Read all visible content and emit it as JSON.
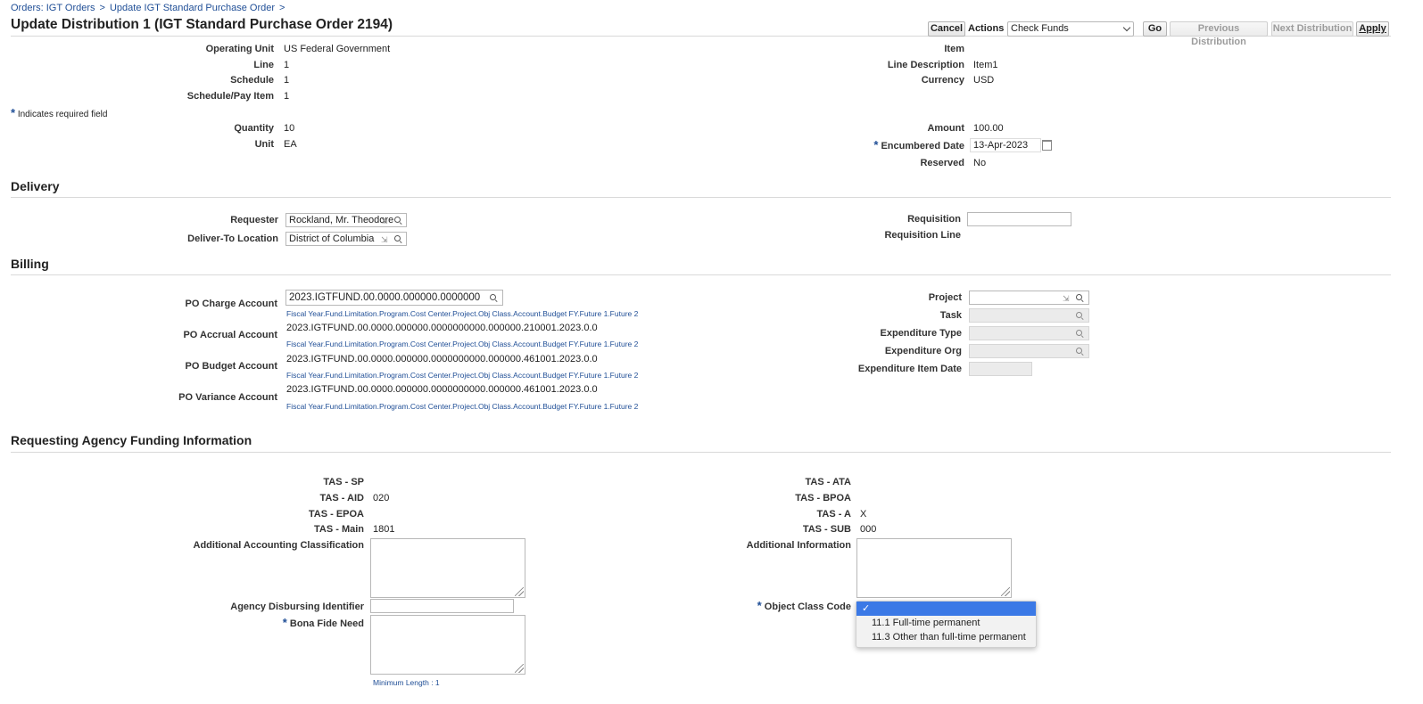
{
  "breadcrumb": {
    "item1": "Orders: IGT Orders",
    "item2": "Update IGT Standard Purchase Order",
    "sep": ">"
  },
  "page_title": "Update Distribution 1 (IGT Standard Purchase Order 2194)",
  "toolbar": {
    "cancel": "Cancel",
    "actions_label": "Actions",
    "actions_value": "Check Funds",
    "go": "Go",
    "previous": "Previous Distribution",
    "next": "Next Distribution",
    "apply": "Apply"
  },
  "header": {
    "operating_unit_label": "Operating Unit",
    "operating_unit": "US Federal Government",
    "line_label": "Line",
    "line": "1",
    "schedule_label": "Schedule",
    "schedule": "1",
    "pay_item_label": "Schedule/Pay Item",
    "pay_item": "1",
    "item_label": "Item",
    "item": "",
    "line_desc_label": "Line Description",
    "line_desc": "Item1",
    "currency_label": "Currency",
    "currency": "USD",
    "required_note": "Indicates required field",
    "quantity_label": "Quantity",
    "quantity": "10",
    "unit_label": "Unit",
    "unit": "EA",
    "amount_label": "Amount",
    "amount": "100.00",
    "encumbered_label": "Encumbered Date",
    "encumbered": "13-Apr-2023",
    "reserved_label": "Reserved",
    "reserved": "No",
    "required_star": "*"
  },
  "delivery": {
    "title": "Delivery",
    "requester_label": "Requester",
    "requester": "Rockland, Mr. Theodore",
    "deliver_to_label": "Deliver-To Location",
    "deliver_to": "District of Columbia",
    "requisition_label": "Requisition",
    "requisition": "",
    "requisition_line_label": "Requisition Line"
  },
  "billing": {
    "title": "Billing",
    "charge_label": "PO Charge Account",
    "charge": "2023.IGTFUND.00.0000.000000.0000000",
    "accrual_label": "PO Accrual Account",
    "accrual": "2023.IGTFUND.00.0000.000000.0000000000.000000.210001.2023.0.0",
    "budget_label": "PO Budget Account",
    "budget": "2023.IGTFUND.00.0000.000000.0000000000.000000.461001.2023.0.0",
    "variance_label": "PO Variance Account",
    "variance": "2023.IGTFUND.00.0000.000000.0000000000.000000.461001.2023.0.0",
    "segments_hint": "Fiscal Year.Fund.Limitation.Program.Cost Center.Project.Obj Class.Account.Budget FY.Future 1.Future 2",
    "project_label": "Project",
    "task_label": "Task",
    "exp_type_label": "Expenditure Type",
    "exp_org_label": "Expenditure Org",
    "exp_item_date_label": "Expenditure Item Date"
  },
  "funding": {
    "title": "Requesting Agency Funding Information",
    "tas_sp_label": "TAS - SP",
    "tas_sp": "",
    "tas_aid_label": "TAS - AID",
    "tas_aid": "020",
    "tas_epoa_label": "TAS - EPOA",
    "tas_epoa": "",
    "tas_main_label": "TAS - Main",
    "tas_main": "1801",
    "aac_label": "Additional Accounting Classification",
    "adi_label": "Agency Disbursing Identifier",
    "bfn_label": "Bona Fide Need",
    "min_length": "Minimum Length : 1",
    "tas_ata_label": "TAS - ATA",
    "tas_ata": "",
    "tas_bpoa_label": "TAS - BPOA",
    "tas_bpoa": "",
    "tas_a_label": "TAS - A",
    "tas_a": "X",
    "tas_sub_label": "TAS - SUB",
    "tas_sub": "000",
    "addl_info_label": "Additional Information",
    "occ_label": "Object Class Code",
    "occ_options": [
      "",
      "11.1 Full-time permanent",
      "11.3 Other than full-time permanent"
    ],
    "occ_check": "✓"
  }
}
